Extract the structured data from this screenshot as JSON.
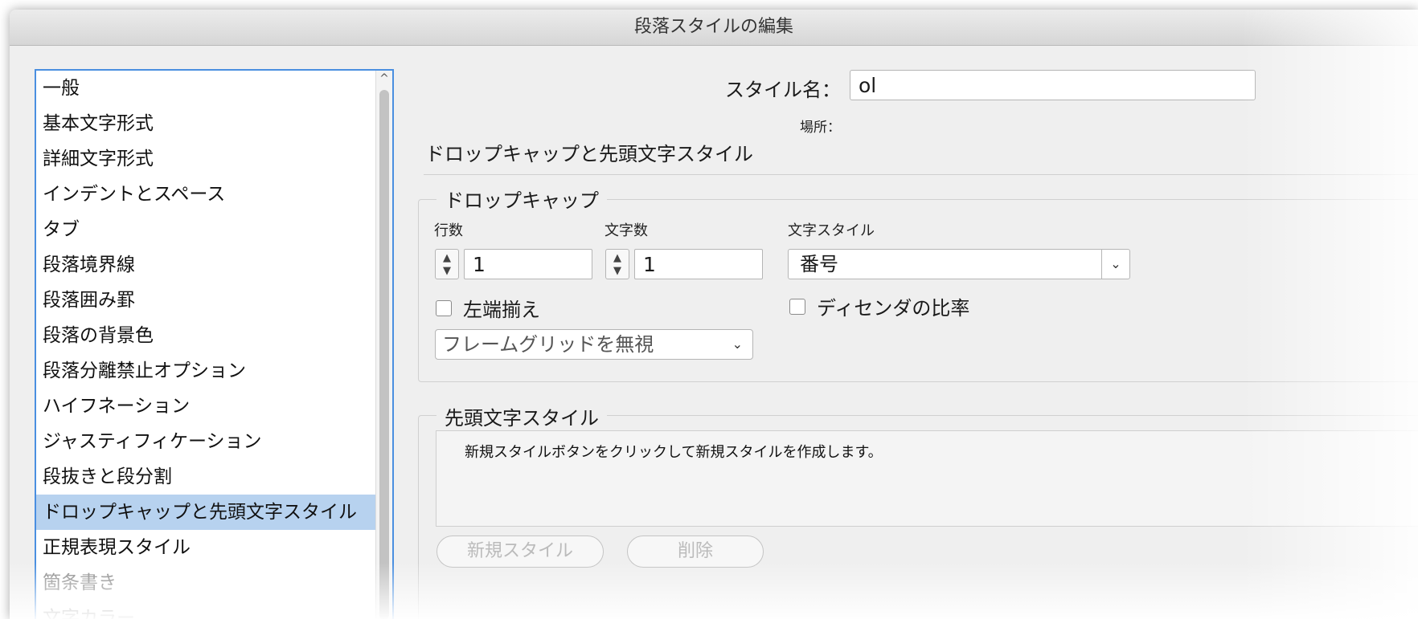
{
  "window": {
    "title": "段落スタイルの編集"
  },
  "sidebar": {
    "items": [
      {
        "label": "一般"
      },
      {
        "label": "基本文字形式"
      },
      {
        "label": "詳細文字形式"
      },
      {
        "label": "インデントとスペース"
      },
      {
        "label": "タブ"
      },
      {
        "label": "段落境界線"
      },
      {
        "label": "段落囲み罫"
      },
      {
        "label": "段落の背景色"
      },
      {
        "label": "段落分離禁止オプション"
      },
      {
        "label": "ハイフネーション"
      },
      {
        "label": "ジャスティフィケーション"
      },
      {
        "label": "段抜きと段分割"
      },
      {
        "label": "ドロップキャップと先頭文字スタイル"
      },
      {
        "label": "正規表現スタイル"
      },
      {
        "label": "箇条書き"
      },
      {
        "label": "文字カラー"
      }
    ],
    "selected": "ドロップキャップと先頭文字スタイル"
  },
  "style_name": {
    "label": "スタイル名：",
    "value": "ol"
  },
  "location": {
    "label": "場所："
  },
  "section": {
    "title": "ドロップキャップと先頭文字スタイル"
  },
  "drop_cap": {
    "legend": "ドロップキャップ",
    "lines_label": "行数",
    "lines_value": "1",
    "chars_label": "文字数",
    "chars_value": "1",
    "char_style_label": "文字スタイル",
    "char_style_value": "番号",
    "align_left_label": "左端揃え",
    "descender_label": "ディセンダの比率",
    "frame_grid_value": "フレームグリッドを無視"
  },
  "nested_styles": {
    "legend": "先頭文字スタイル",
    "message": "新規スタイルボタンをクリックして新規スタイルを作成します。",
    "new_style_button": "新規スタイル",
    "delete_button": "削除"
  },
  "icons": {
    "stepper_up": "▲",
    "stepper_down": "▼",
    "chevron": "⌄",
    "scroll_up": "^"
  }
}
